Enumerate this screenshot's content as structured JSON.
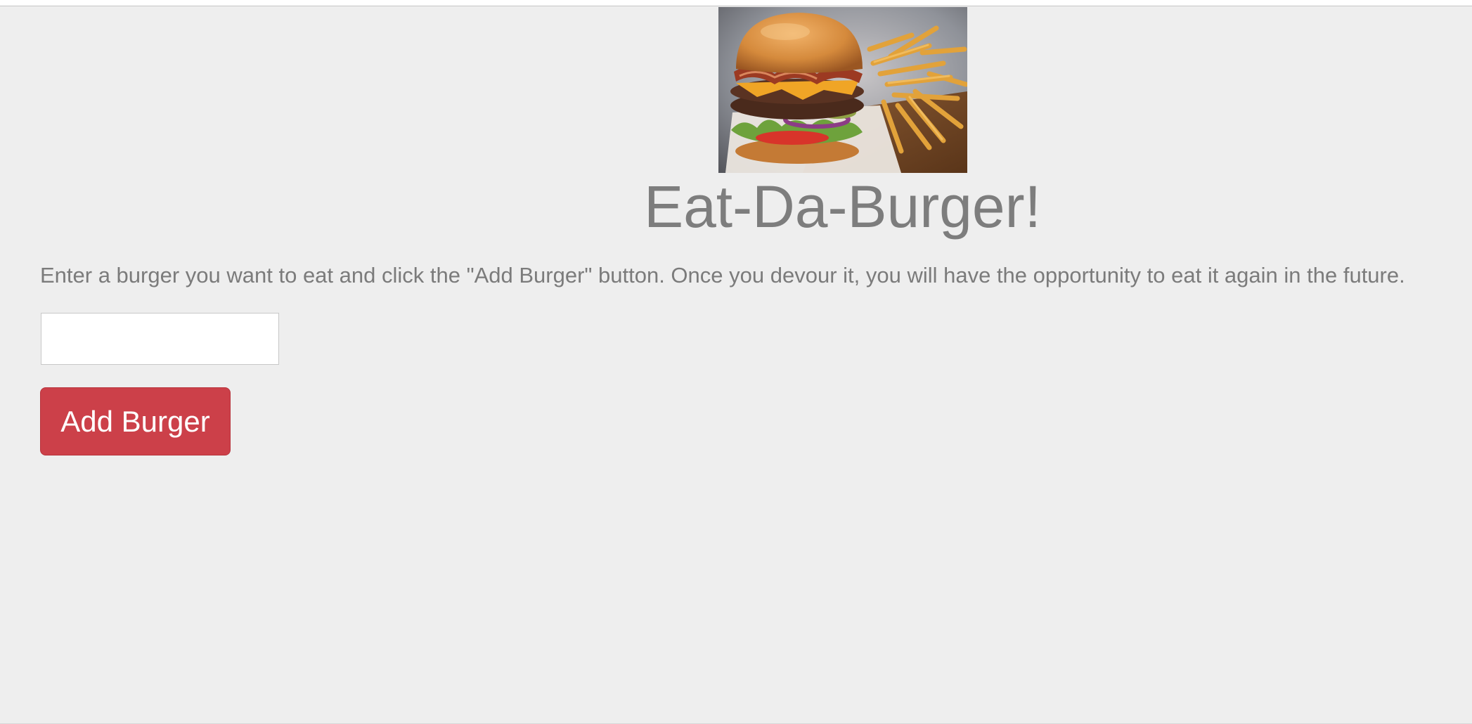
{
  "header": {
    "image_alt": "burger-and-fries-photo",
    "title": "Eat-Da-Burger!"
  },
  "main": {
    "instructions": "Enter a burger you want to eat and click the \"Add Burger\" button. Once you devour it, you will have the opportunity to eat it again in the future.",
    "burger_input": {
      "value": "",
      "placeholder": ""
    },
    "add_button_label": "Add Burger"
  },
  "colors": {
    "page_background": "#eeeeee",
    "text": "#7b7b7b",
    "button": "#cc4049",
    "button_text": "#ffffff"
  }
}
